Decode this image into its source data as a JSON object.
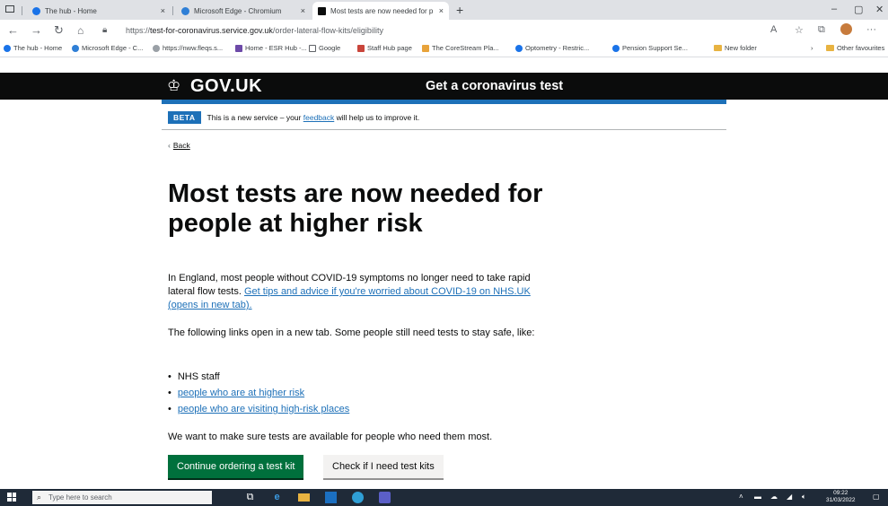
{
  "browser": {
    "tabs": [
      {
        "label": "The hub - Home",
        "active": false
      },
      {
        "label": "Microsoft Edge - Chromium",
        "active": false
      },
      {
        "label": "Most tests are now needed for p",
        "active": true
      }
    ],
    "new_tab": "+",
    "close_glyph": "×",
    "window_controls": {
      "minimize": "–",
      "maximize": "▢",
      "close": "✕"
    },
    "url_prefix": "https://",
    "url_domain": "test-for-coronavirus.service.gov.uk",
    "url_path": "/order-lateral-flow-kits/eligibility",
    "bookmarks": [
      {
        "label": "The hub - Home",
        "icon": "hub-icon"
      },
      {
        "label": "Microsoft Edge - C...",
        "icon": "edge-icon"
      },
      {
        "label": "https://nww.fleqs.s...",
        "icon": "link-icon"
      },
      {
        "label": "Home - ESR Hub -...",
        "icon": "esr-icon"
      },
      {
        "label": "Google",
        "icon": "google-icon"
      },
      {
        "label": "Staff Hub page",
        "icon": "staff-icon"
      },
      {
        "label": "The CoreStream Pla...",
        "icon": "corestream-icon"
      },
      {
        "label": "Optometry - Restric...",
        "icon": "optometry-icon"
      },
      {
        "label": "Pension Support Se...",
        "icon": "pension-icon"
      },
      {
        "label": "New folder",
        "icon": "folder-icon"
      }
    ],
    "other_favourites": "Other favourites"
  },
  "gov": {
    "logo": "GOV.UK",
    "service_name": "Get a coronavirus test"
  },
  "banner": {
    "tag": "BETA",
    "text_before": "This is a new service – your ",
    "link": "feedback",
    "text_after": " will help us to improve it."
  },
  "back_link": "Back",
  "heading": "Most tests are now needed for people at higher risk",
  "para1_text": "In England, most people without COVID-19 symptoms no longer need to take rapid lateral flow tests. ",
  "para1_link": "Get tips and advice if you're worried about COVID-19 on NHS.UK (opens in new tab).",
  "para2": "The following links open in a new tab. Some people still need tests to stay safe, like:",
  "list": {
    "item1": "NHS staff",
    "item2_link": "people who are at higher risk",
    "item3_link": "people who are visiting high-risk places"
  },
  "para3": "We want to make sure tests are available for people who need them most.",
  "buttons": {
    "primary": "Continue ordering a test kit",
    "secondary": "Check if I need test kits"
  },
  "taskbar": {
    "search_placeholder": "Type here to search",
    "time": "09:22",
    "date": "31/03/2022"
  },
  "colors": {
    "gov_black": "#0b0c0c",
    "gov_blue": "#1d70b8",
    "gov_green": "#00703c",
    "taskbar": "#1f2a38"
  }
}
